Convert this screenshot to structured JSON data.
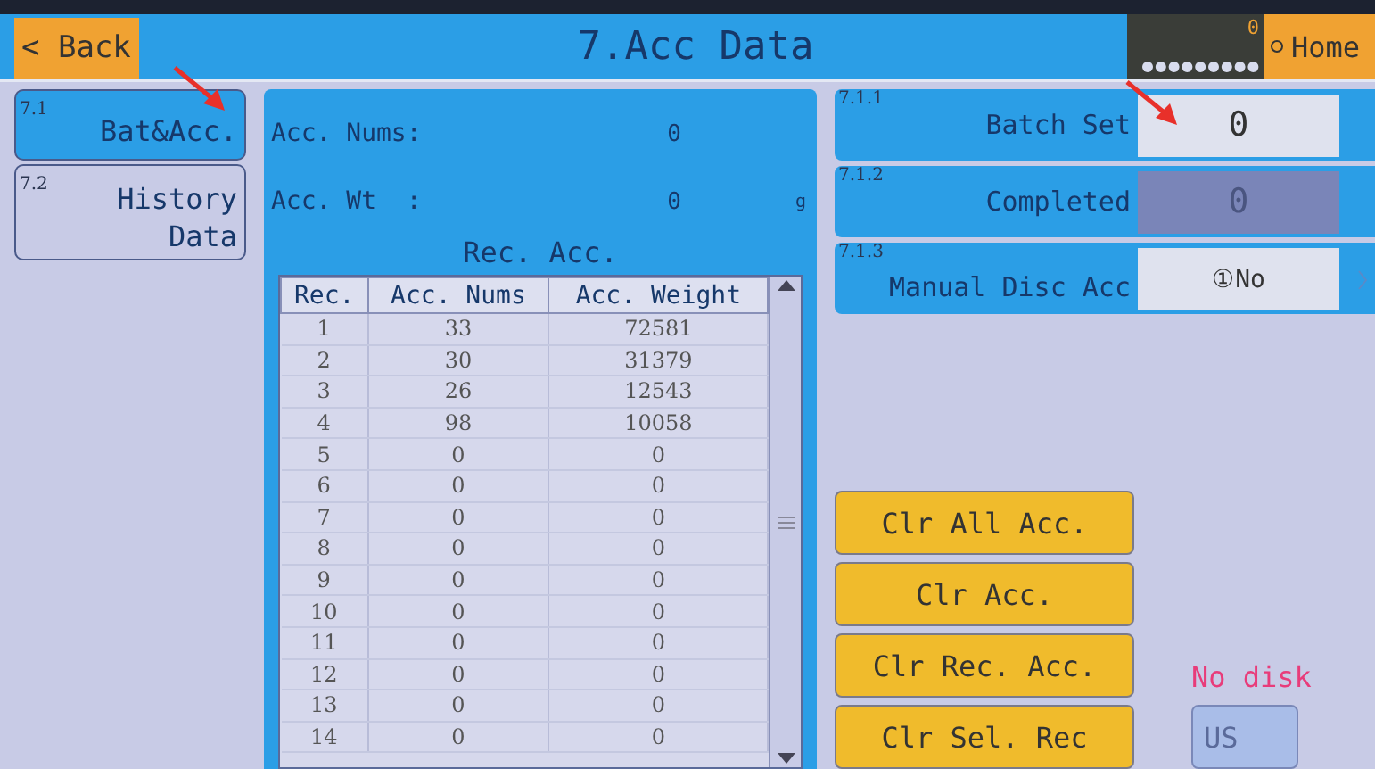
{
  "header": {
    "back": "< Back",
    "title": "7.Acc Data",
    "counter": "0",
    "home": "Home"
  },
  "tabs": [
    {
      "number": "7.1",
      "label": "Bat&Acc.",
      "selected": true
    },
    {
      "number": "7.2",
      "label": "History Data",
      "selected": false
    }
  ],
  "summary": [
    {
      "label": "Acc. Nums:",
      "value": "0"
    },
    {
      "label": "Acc. Wt  :",
      "value": "0",
      "unit": "g"
    }
  ],
  "records": {
    "title": "Rec. Acc.",
    "columns": [
      "Rec.",
      "Acc. Nums",
      "Acc. Weight"
    ],
    "rows": [
      [
        "1",
        "33",
        "72581"
      ],
      [
        "2",
        "30",
        "31379"
      ],
      [
        "3",
        "26",
        "12543"
      ],
      [
        "4",
        "98",
        "10058"
      ],
      [
        "5",
        "0",
        "0"
      ],
      [
        "6",
        "0",
        "0"
      ],
      [
        "7",
        "0",
        "0"
      ],
      [
        "8",
        "0",
        "0"
      ],
      [
        "9",
        "0",
        "0"
      ],
      [
        "10",
        "0",
        "0"
      ],
      [
        "11",
        "0",
        "0"
      ],
      [
        "12",
        "0",
        "0"
      ],
      [
        "13",
        "0",
        "0"
      ],
      [
        "14",
        "0",
        "0"
      ]
    ]
  },
  "settings": [
    {
      "number": "7.1.1",
      "label": "Batch Set",
      "value": "0",
      "kind": "input"
    },
    {
      "number": "7.1.2",
      "label": "Completed",
      "value": "0",
      "kind": "readonly"
    },
    {
      "number": "7.1.3",
      "label": "Manual Disc Acc",
      "value": "①No",
      "kind": "select"
    }
  ],
  "actions": [
    "Clr All Acc.",
    "Clr Acc.",
    "Clr Rec. Acc.",
    "Clr Sel. Rec"
  ],
  "usb": {
    "status": "No disk",
    "button": "US"
  }
}
